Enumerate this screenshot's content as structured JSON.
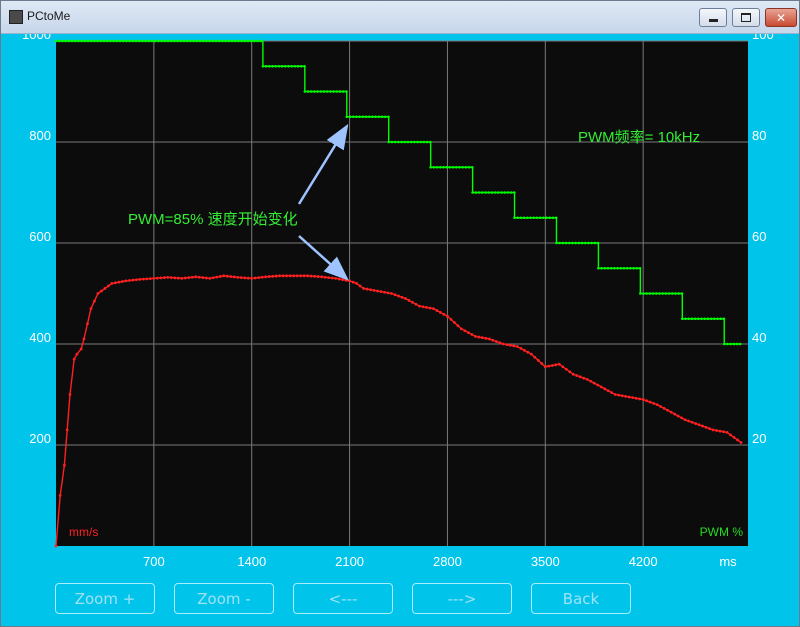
{
  "window": {
    "title": "PCtoMe"
  },
  "chart_data": {
    "type": "line",
    "x_ticks": [
      700,
      1400,
      2100,
      2800,
      3500,
      4200
    ],
    "x_unit": "ms",
    "xlim": [
      0,
      4950
    ],
    "y_left": {
      "ticks": [
        200,
        400,
        600,
        800,
        1000
      ],
      "label": "mm/s",
      "ylim": [
        0,
        1000
      ]
    },
    "y_right": {
      "ticks": [
        20,
        40,
        60,
        80,
        100
      ],
      "label": "PWM %",
      "ylim": [
        0,
        100
      ]
    },
    "grid": true,
    "annotations": [
      {
        "text": "PWM=85% 速度开始变化"
      },
      {
        "text": "PWM频率= 10kHz"
      }
    ],
    "series": [
      {
        "axis": "right",
        "color": "#00ff00",
        "step": true,
        "x": [
          0,
          1480,
          1780,
          2080,
          2380,
          2680,
          2980,
          3280,
          3580,
          3880,
          4180,
          4480,
          4780,
          4900
        ],
        "values": [
          100,
          95,
          90,
          85,
          80,
          75,
          70,
          65,
          60,
          55,
          50,
          45,
          40,
          40
        ]
      },
      {
        "axis": "left",
        "color": "#ff2020",
        "x": [
          0,
          30,
          60,
          80,
          100,
          130,
          150,
          180,
          200,
          250,
          300,
          400,
          500,
          600,
          700,
          800,
          900,
          1000,
          1100,
          1200,
          1300,
          1400,
          1500,
          1600,
          1700,
          1800,
          1900,
          2000,
          2100,
          2150,
          2200,
          2300,
          2400,
          2500,
          2600,
          2700,
          2800,
          2900,
          3000,
          3100,
          3200,
          3300,
          3400,
          3500,
          3600,
          3700,
          3800,
          3900,
          4000,
          4100,
          4200,
          4300,
          4400,
          4500,
          4600,
          4700,
          4800,
          4900
        ],
        "values": [
          0,
          100,
          160,
          230,
          300,
          370,
          380,
          390,
          410,
          470,
          500,
          520,
          525,
          528,
          530,
          532,
          530,
          533,
          530,
          535,
          532,
          530,
          533,
          535,
          535,
          535,
          533,
          530,
          525,
          520,
          510,
          505,
          500,
          490,
          475,
          470,
          455,
          430,
          415,
          410,
          400,
          395,
          380,
          355,
          360,
          340,
          330,
          315,
          300,
          295,
          290,
          280,
          265,
          250,
          240,
          230,
          225,
          205
        ]
      }
    ]
  },
  "toolbar": {
    "zoom_in": "Zoom +",
    "zoom_out": "Zoom -",
    "prev": "<---",
    "next": "--->",
    "back": "Back"
  }
}
